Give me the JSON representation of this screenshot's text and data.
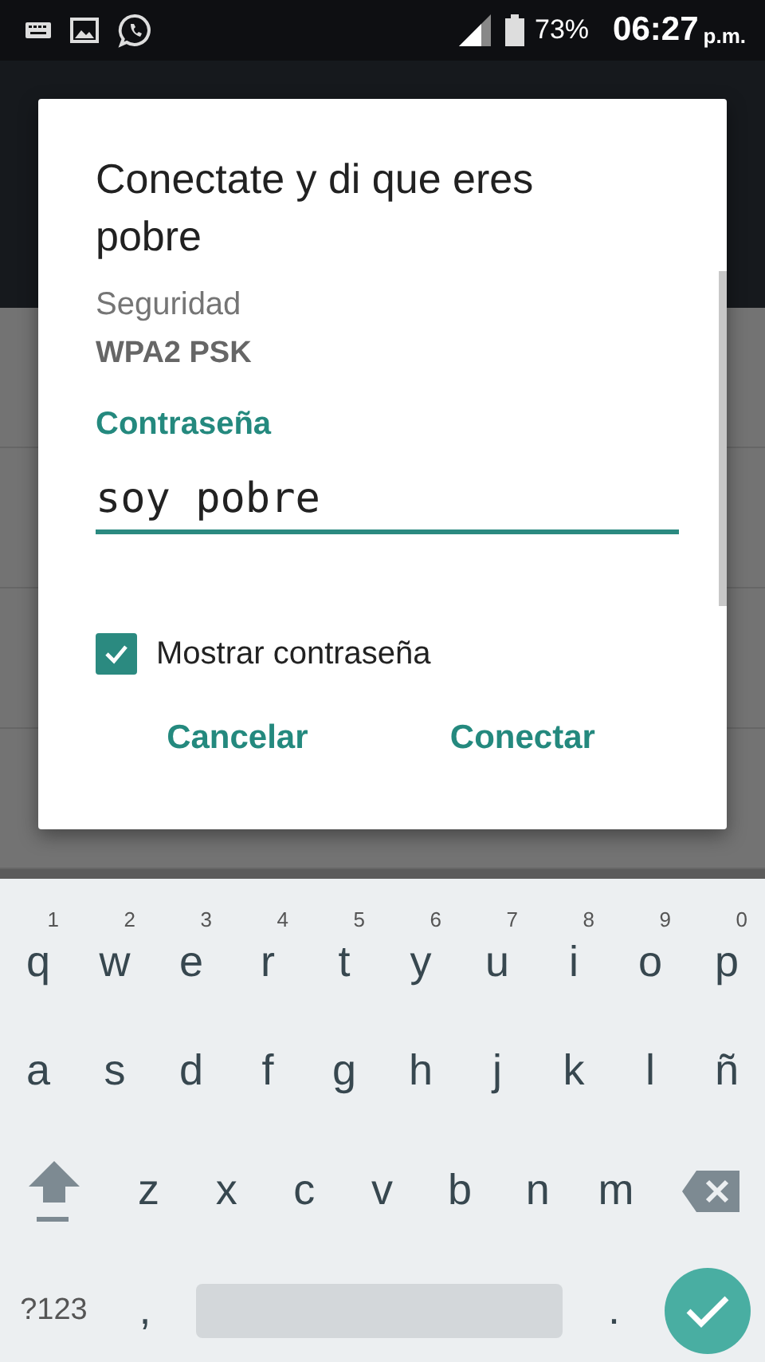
{
  "status_bar": {
    "battery": "73%",
    "time": "06:27",
    "ampm": "p.m."
  },
  "dialog": {
    "title": "Conectate y di que eres pobre",
    "security_label": "Seguridad",
    "security_value": "WPA2 PSK",
    "password_label": "Contraseña",
    "password_value": "soy pobre",
    "show_password": {
      "label": "Mostrar contraseña",
      "checked": true
    },
    "buttons": [
      "Cancelar",
      "Conectar"
    ]
  },
  "keyboard": {
    "rows": [
      {
        "keys": [
          {
            "kind": "letter",
            "label": "q",
            "hint": "1"
          },
          {
            "kind": "letter",
            "label": "w",
            "hint": "2"
          },
          {
            "kind": "letter",
            "label": "e",
            "hint": "3"
          },
          {
            "kind": "letter",
            "label": "r",
            "hint": "4"
          },
          {
            "kind": "letter",
            "label": "t",
            "hint": "5"
          },
          {
            "kind": "letter",
            "label": "y",
            "hint": "6"
          },
          {
            "kind": "letter",
            "label": "u",
            "hint": "7"
          },
          {
            "kind": "letter",
            "label": "i",
            "hint": "8"
          },
          {
            "kind": "letter",
            "label": "o",
            "hint": "9"
          },
          {
            "kind": "letter",
            "label": "p",
            "hint": "0"
          }
        ]
      },
      {
        "keys": [
          {
            "kind": "letter",
            "label": "a"
          },
          {
            "kind": "letter",
            "label": "s"
          },
          {
            "kind": "letter",
            "label": "d"
          },
          {
            "kind": "letter",
            "label": "f"
          },
          {
            "kind": "letter",
            "label": "g"
          },
          {
            "kind": "letter",
            "label": "h"
          },
          {
            "kind": "letter",
            "label": "j"
          },
          {
            "kind": "letter",
            "label": "k"
          },
          {
            "kind": "letter",
            "label": "l"
          },
          {
            "kind": "letter",
            "label": "ñ"
          }
        ]
      },
      {
        "keys": [
          {
            "kind": "shift"
          },
          {
            "kind": "letter",
            "label": "z"
          },
          {
            "kind": "letter",
            "label": "x"
          },
          {
            "kind": "letter",
            "label": "c"
          },
          {
            "kind": "letter",
            "label": "v"
          },
          {
            "kind": "letter",
            "label": "b"
          },
          {
            "kind": "letter",
            "label": "n"
          },
          {
            "kind": "letter",
            "label": "m"
          },
          {
            "kind": "backspace"
          }
        ]
      },
      {
        "keys": [
          {
            "kind": "symbols",
            "label": "?123"
          },
          {
            "kind": "letter",
            "label": ","
          },
          {
            "kind": "space"
          },
          {
            "kind": "letter",
            "label": "."
          },
          {
            "kind": "enter"
          }
        ]
      }
    ]
  }
}
